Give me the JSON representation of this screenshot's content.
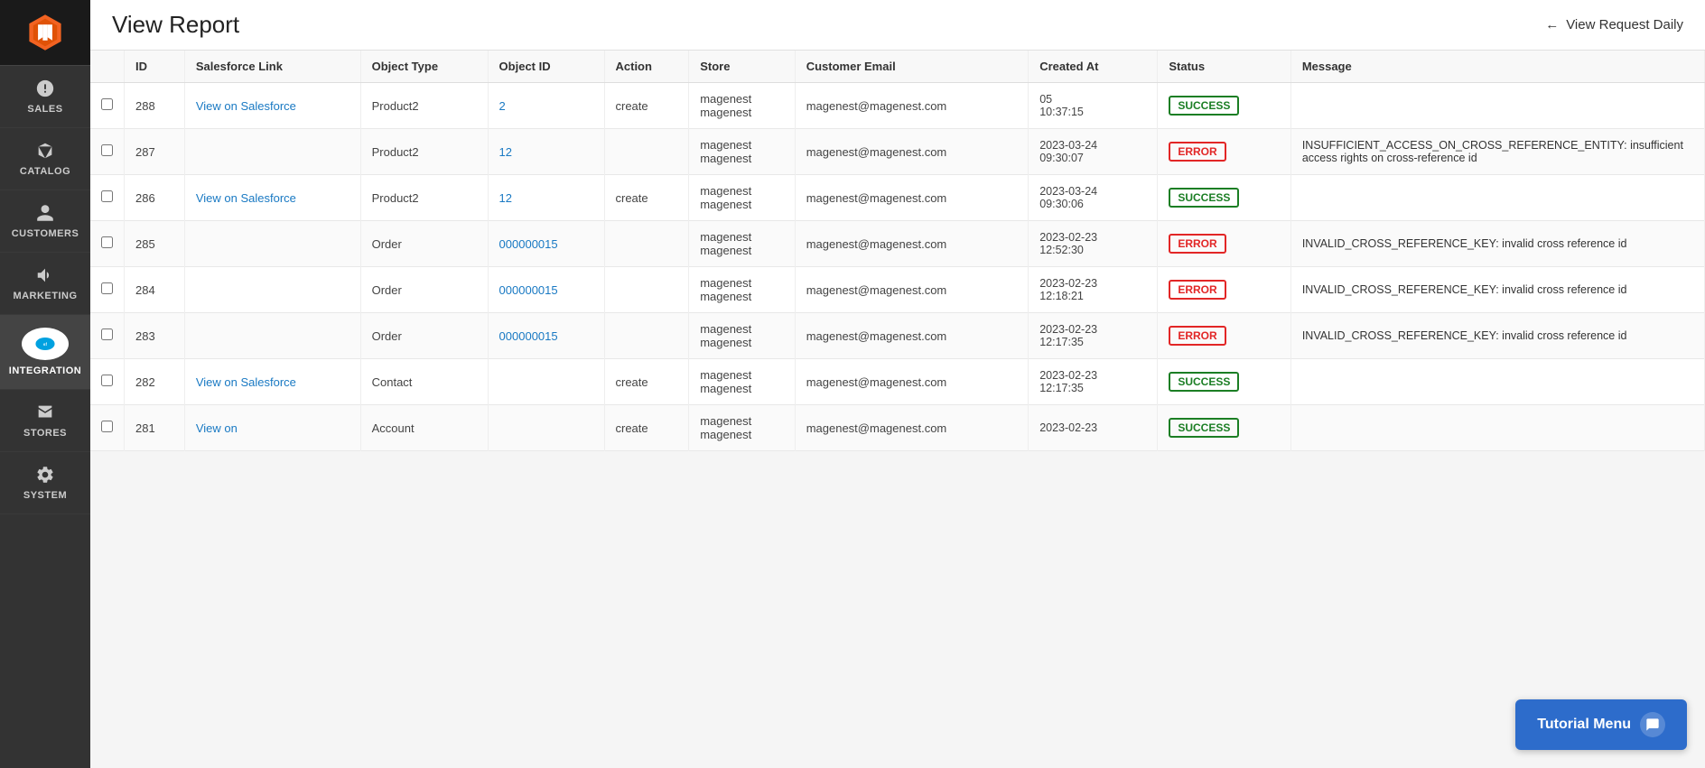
{
  "header": {
    "title": "View Report",
    "back_label": "View Request Daily",
    "back_arrow": "←"
  },
  "sidebar": {
    "items": [
      {
        "id": "sales",
        "label": "SALES",
        "icon": "dollar"
      },
      {
        "id": "catalog",
        "label": "CATALOG",
        "icon": "box"
      },
      {
        "id": "customers",
        "label": "CUSTOMERS",
        "icon": "person"
      },
      {
        "id": "marketing",
        "label": "MARKETING",
        "icon": "megaphone"
      },
      {
        "id": "integration",
        "label": "INTEGRATION",
        "icon": "salesforce"
      },
      {
        "id": "stores",
        "label": "STORES",
        "icon": "store"
      },
      {
        "id": "system",
        "label": "SYSTEM",
        "icon": "gear"
      }
    ]
  },
  "table": {
    "columns": [
      "",
      "ID",
      "Salesforce Link",
      "Object Type",
      "Object ID",
      "Action",
      "Store",
      "Customer Email",
      "Created At",
      "Status",
      "Message"
    ],
    "rows": [
      {
        "id": "288",
        "sf_link": "View on Salesforce",
        "object_type": "Product2",
        "object_id": "2",
        "action": "create",
        "store": "magenest\nmagenest",
        "email": "magenest@magenest.com",
        "created_at": "05\n10:37:15",
        "status": "SUCCESS",
        "message": ""
      },
      {
        "id": "287",
        "sf_link": "",
        "object_type": "Product2",
        "object_id": "12",
        "action": "",
        "store": "magenest\nmagenest",
        "email": "magenest@magenest.com",
        "created_at": "2023-03-24\n09:30:07",
        "status": "ERROR",
        "message": "INSUFFICIENT_ACCESS_ON_CROSS_REFERENCE_ENTITY: insufficient access rights on cross-reference id"
      },
      {
        "id": "286",
        "sf_link": "View on Salesforce",
        "object_type": "Product2",
        "object_id": "12",
        "action": "create",
        "store": "magenest\nmagenest",
        "email": "magenest@magenest.com",
        "created_at": "2023-03-24\n09:30:06",
        "status": "SUCCESS",
        "message": ""
      },
      {
        "id": "285",
        "sf_link": "",
        "object_type": "Order",
        "object_id": "000000015",
        "action": "",
        "store": "magenest\nmagenest",
        "email": "magenest@magenest.com",
        "created_at": "2023-02-23\n12:52:30",
        "status": "ERROR",
        "message": "INVALID_CROSS_REFERENCE_KEY: invalid cross reference id"
      },
      {
        "id": "284",
        "sf_link": "",
        "object_type": "Order",
        "object_id": "000000015",
        "action": "",
        "store": "magenest\nmagenest",
        "email": "magenest@magenest.com",
        "created_at": "2023-02-23\n12:18:21",
        "status": "ERROR",
        "message": "INVALID_CROSS_REFERENCE_KEY: invalid cross reference id"
      },
      {
        "id": "283",
        "sf_link": "",
        "object_type": "Order",
        "object_id": "000000015",
        "action": "",
        "store": "magenest\nmagenest",
        "email": "magenest@magenest.com",
        "created_at": "2023-02-23\n12:17:35",
        "status": "ERROR",
        "message": "INVALID_CROSS_REFERENCE_KEY: invalid cross reference id"
      },
      {
        "id": "282",
        "sf_link": "View on Salesforce",
        "object_type": "Contact",
        "object_id": "",
        "action": "create",
        "store": "magenest\nmagenest",
        "email": "magenest@magenest.com",
        "created_at": "2023-02-23\n12:17:35",
        "status": "SUCCESS",
        "message": ""
      },
      {
        "id": "281",
        "sf_link": "View on",
        "object_type": "Account",
        "object_id": "",
        "action": "create",
        "store": "magenest\nmagenest",
        "email": "magenest@magenest.com",
        "created_at": "2023-02-23",
        "status": "SUCCESS",
        "message": ""
      }
    ]
  },
  "tutorial": {
    "label": "Tutorial Menu",
    "chat_icon": "💬"
  }
}
